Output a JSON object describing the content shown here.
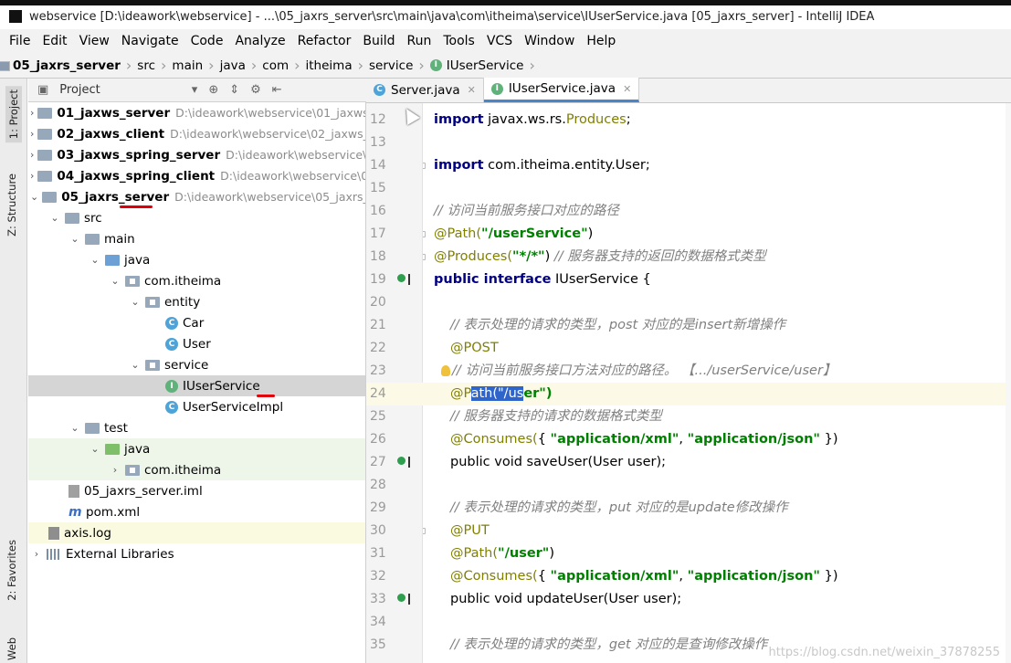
{
  "window": {
    "title": "webservice [D:\\ideawork\\webservice] - ...\\05_jaxrs_server\\src\\main\\java\\com\\itheima\\service\\IUserService.java [05_jaxrs_server] - IntelliJ IDEA"
  },
  "menu": [
    "File",
    "Edit",
    "View",
    "Navigate",
    "Code",
    "Analyze",
    "Refactor",
    "Build",
    "Run",
    "Tools",
    "VCS",
    "Window",
    "Help"
  ],
  "breadcrumb": [
    "05_jaxrs_server",
    "src",
    "main",
    "java",
    "com",
    "itheima",
    "service",
    "IUserService"
  ],
  "sidebar": {
    "project_tab": "1: Project",
    "structure_tab": "Z: Structure",
    "favorites_tab": "2: Favorites",
    "web_tab": "Web"
  },
  "project_panel": {
    "title": "Project"
  },
  "tree": [
    {
      "name": "01_jaxws_server",
      "path": "D:\\ideawork\\webservice\\01_jaxws_"
    },
    {
      "name": "02_jaxws_client",
      "path": "D:\\ideawork\\webservice\\02_jaxws_"
    },
    {
      "name": "03_jaxws_spring_server",
      "path": "D:\\ideawork\\webservice\\0"
    },
    {
      "name": "04_jaxws_spring_client",
      "path": "D:\\ideawork\\webservice\\04"
    },
    {
      "name": "05_jaxrs_server",
      "path": "D:\\ideawork\\webservice\\05_jaxrs_s"
    },
    {
      "name": "src"
    },
    {
      "name": "main"
    },
    {
      "name": "java"
    },
    {
      "name": "com.itheima"
    },
    {
      "name": "entity"
    },
    {
      "name": "Car"
    },
    {
      "name": "User"
    },
    {
      "name": "service"
    },
    {
      "name": "IUserService"
    },
    {
      "name": "UserServiceImpl"
    },
    {
      "name": "test"
    },
    {
      "name": "java"
    },
    {
      "name": "com.itheima"
    },
    {
      "name": "05_jaxrs_server.iml"
    },
    {
      "name": "pom.xml"
    },
    {
      "name": "axis.log"
    },
    {
      "name": "External Libraries"
    }
  ],
  "tabs": [
    {
      "label": "Server.java"
    },
    {
      "label": "IUserService.java"
    }
  ],
  "gutter": [
    "12",
    "13",
    "14",
    "15",
    "16",
    "17",
    "18",
    "19",
    "20",
    "21",
    "22",
    "23",
    "24",
    "25",
    "26",
    "27",
    "28",
    "29",
    "30",
    "31",
    "32",
    "33",
    "34",
    "35"
  ],
  "code": {
    "l12_kw": "import",
    "l12_rest": " javax.ws.rs.",
    "l12_cls": "Produces",
    "l12_end": ";",
    "l14_kw": "import",
    "l14_rest": " com.itheima.entity.User;",
    "l16_cm": "// 访问当前服务接口对应的路径",
    "l17_an": "@Path(",
    "l17_str": "\"/userService\"",
    "l17_end": ")",
    "l18_an": "@Produces(",
    "l18_str": "\"*/*\"",
    "l18_end": ")",
    "l18_cm": " // 服务器支持的返回的数据格式类型",
    "l19_kw": "public interface",
    "l19_rest": " IUserService {",
    "l21_cm": "// 表示处理的请求的类型，post 对应的是insert新增操作",
    "l22_an": "@POST",
    "l23_cm": "// 访问当前服务接口方法对应的路径。 【.../userService/user】",
    "l24_a": "@P",
    "l24_hl": "ath(\"/us",
    "l24_b": "er\")",
    "l25_cm": "// 服务器支持的请求的数据格式类型",
    "l26_an": "@Consumes(",
    "l26_p": "{ ",
    "l26_s1": "\"application/xml\"",
    "l26_c": ", ",
    "l26_s2": "\"application/json\"",
    "l26_end": " })",
    "l27_kw": "public void",
    "l27_rest": " saveUser(User user);",
    "l29_cm": "// 表示处理的请求的类型，put 对应的是update修改操作",
    "l30_an": "@PUT",
    "l31_an": "@Path(",
    "l31_str": "\"/user\"",
    "l31_end": ")",
    "l32_an": "@Consumes(",
    "l32_p": "{ ",
    "l32_s1": "\"application/xml\"",
    "l32_c": ", ",
    "l32_s2": "\"application/json\"",
    "l32_end": " })",
    "l33_kw": "public void",
    "l33_rest": " updateUser(User user);",
    "l35_cm": "// 表示处理的请求的类型，get 对应的是查询修改操作"
  },
  "watermark": "https://blog.csdn.net/weixin_37878255"
}
